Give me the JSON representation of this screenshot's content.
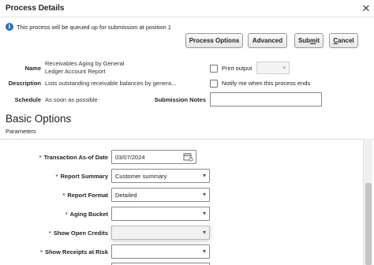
{
  "dialog": {
    "title": "Process Details",
    "close_glyph": "✕"
  },
  "info": {
    "icon": "info-icon",
    "message": "This process will be queued up for submission at position 1"
  },
  "toolbar": {
    "process_options": "Process Options",
    "advanced": "Advanced",
    "submit_pre": "Sub",
    "submit_u": "m",
    "submit_post": "it",
    "cancel_u": "C",
    "cancel_post": "ancel"
  },
  "details": {
    "name_label": "Name",
    "name_value_line1": "Receivables Aging by General",
    "name_value_line2": "Ledger Account Report",
    "description_label": "Description",
    "description_value": "Lists outstanding receivable balances by genera...",
    "schedule_label": "Schedule",
    "schedule_value": "As soon as possible",
    "print_output_label": "Print output",
    "notify_label": "Notify me when this process ends",
    "submission_notes_label": "Submission Notes",
    "submission_notes_value": ""
  },
  "section": {
    "title": "Basic Options",
    "subtitle": "Parameters"
  },
  "parameters": {
    "required_marker": "*",
    "transaction_date_label": "Transaction As-of Date",
    "transaction_date_value": "03/07/2024",
    "report_summary_label": "Report Summary",
    "report_summary_value": "Customer summary",
    "report_format_label": "Report Format",
    "report_format_value": "Detailed",
    "aging_bucket_label": "Aging Bucket",
    "aging_bucket_value": "",
    "show_open_credits_label": "Show Open Credits",
    "show_open_credits_value": "",
    "show_receipts_label": "Show Receipts at Risk",
    "show_receipts_value": ""
  },
  "icons": {
    "dropdown": "chevron-down-icon",
    "calendar": "calendar-icon"
  },
  "colors": {
    "info_icon": "#2f6fb5",
    "required_marker": "#3b6cb5"
  }
}
